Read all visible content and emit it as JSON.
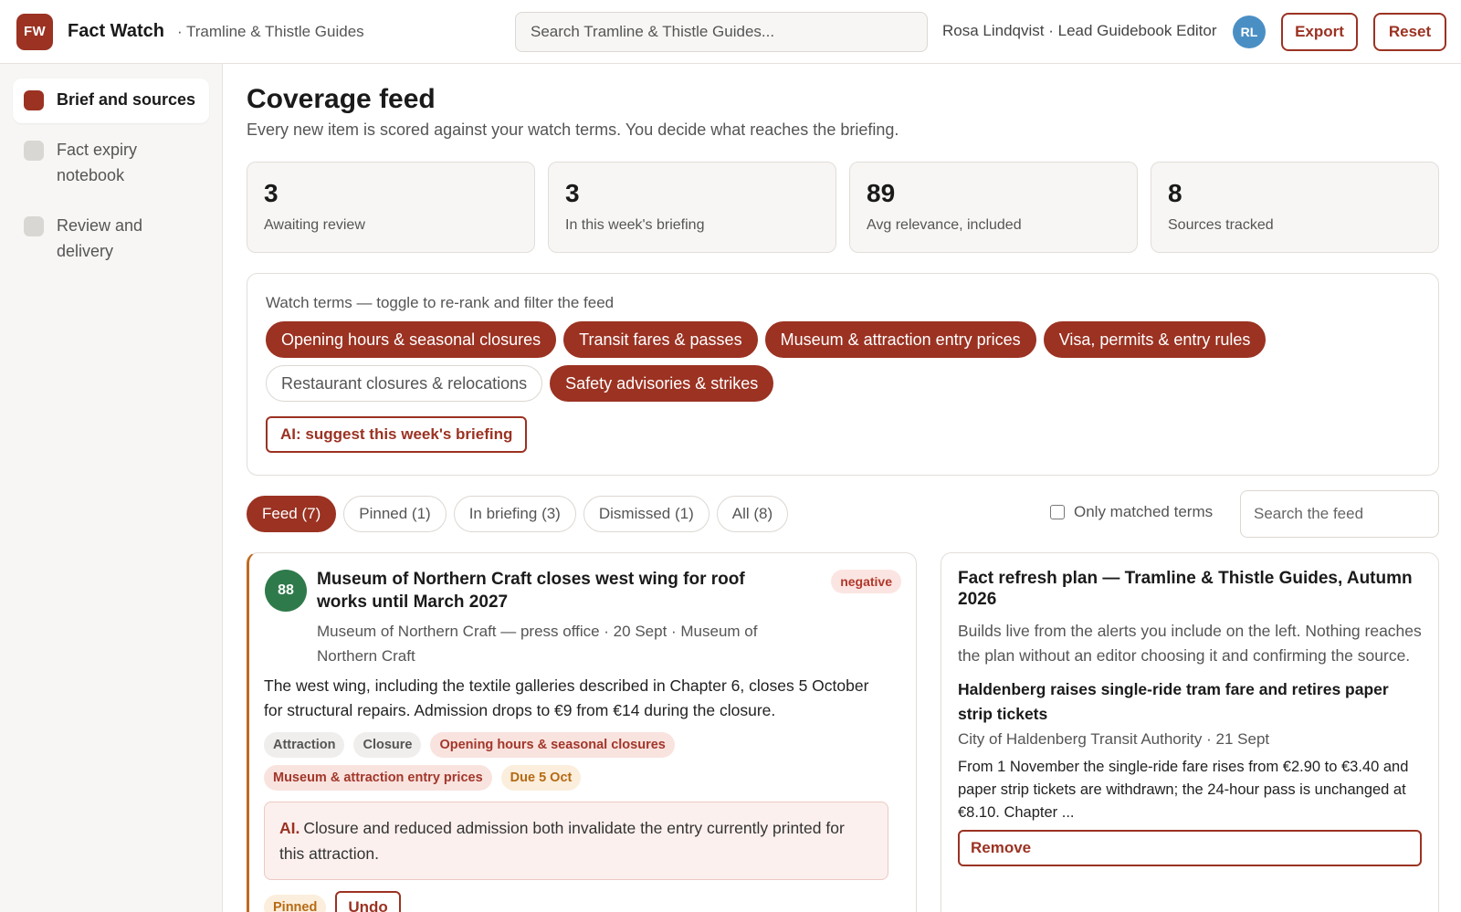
{
  "header": {
    "logo": "FW",
    "app_name": "Fact Watch",
    "org": "· Tramline & Thistle Guides",
    "search_placeholder": "Search Tramline & Thistle Guides...",
    "user": "Rosa Lindqvist · Lead Guidebook Editor",
    "avatar": "RL",
    "export_label": "Export",
    "reset_label": "Reset"
  },
  "sidebar": {
    "items": [
      {
        "label": "Brief and sources",
        "active": true
      },
      {
        "label": "Fact expiry notebook",
        "active": false
      },
      {
        "label": "Review and delivery",
        "active": false
      }
    ]
  },
  "main": {
    "title": "Coverage feed",
    "description": "Every new item is scored against your watch terms. You decide what reaches the briefing.",
    "stats": [
      {
        "value": "3",
        "label": "Awaiting review"
      },
      {
        "value": "3",
        "label": "In this week's briefing"
      },
      {
        "value": "89",
        "label": "Avg relevance, included"
      },
      {
        "value": "8",
        "label": "Sources tracked"
      }
    ],
    "watch_terms": {
      "title": "Watch terms — toggle to re-rank and filter the feed",
      "terms": [
        {
          "label": "Opening hours & seasonal closures",
          "on": true
        },
        {
          "label": "Transit fares & passes",
          "on": true
        },
        {
          "label": "Museum & attraction entry prices",
          "on": true
        },
        {
          "label": "Visa, permits & entry rules",
          "on": true
        },
        {
          "label": "Restaurant closures & relocations",
          "on": false
        },
        {
          "label": "Safety advisories & strikes",
          "on": true
        }
      ],
      "ai_button": "AI: suggest this week's briefing"
    },
    "filters": {
      "tabs": [
        {
          "label": "Feed (7)",
          "active": true
        },
        {
          "label": "Pinned (1)",
          "active": false
        },
        {
          "label": "In briefing (3)",
          "active": false
        },
        {
          "label": "Dismissed (1)",
          "active": false
        },
        {
          "label": "All (8)",
          "active": false
        }
      ],
      "only_matched_label": "Only matched terms",
      "search_placeholder": "Search the feed"
    },
    "feed_item": {
      "score": "88",
      "title": "Museum of Northern Craft closes west wing for roof works until March 2027",
      "sentiment": "negative",
      "meta": "Museum of Northern Craft — press office · 20 Sept · Museum of Northern Craft",
      "body": "The west wing, including the textile galleries described in Chapter 6, closes 5 October for structural repairs. Admission drops to €9 from €14 during the closure.",
      "tags": [
        {
          "label": "Attraction",
          "kind": "grey"
        },
        {
          "label": "Closure",
          "kind": "grey"
        },
        {
          "label": "Opening hours & seasonal closures",
          "kind": "red"
        },
        {
          "label": "Museum & attraction entry prices",
          "kind": "red"
        },
        {
          "label": "Due 5 Oct",
          "kind": "amber"
        }
      ],
      "ai_prefix": "AI.",
      "ai_note": "Closure and reduced admission both invalidate the entry currently printed for this attraction.",
      "pinned_label": "Pinned",
      "undo_label": "Undo"
    },
    "plan": {
      "title": "Fact refresh plan — Tramline & Thistle Guides, Autumn 2026",
      "description": "Builds live from the alerts you include on the left. Nothing reaches the plan without an editor choosing it and confirming the source.",
      "item": {
        "title": "Haldenberg raises single-ride tram fare and retires paper strip tickets",
        "meta": "City of Haldenberg Transit Authority · 21 Sept",
        "body": "From 1 November the single-ride fare rises from €2.90 to €3.40 and paper strip tickets are withdrawn; the 24-hour pass is unchanged at €8.10. Chapter ...",
        "remove_label": "Remove"
      }
    }
  },
  "colors": {
    "brand": "#9b3222",
    "score_green": "#2f7a4b",
    "avatar_blue": "#4a8fc4",
    "accent_border": "#c06a1f"
  }
}
